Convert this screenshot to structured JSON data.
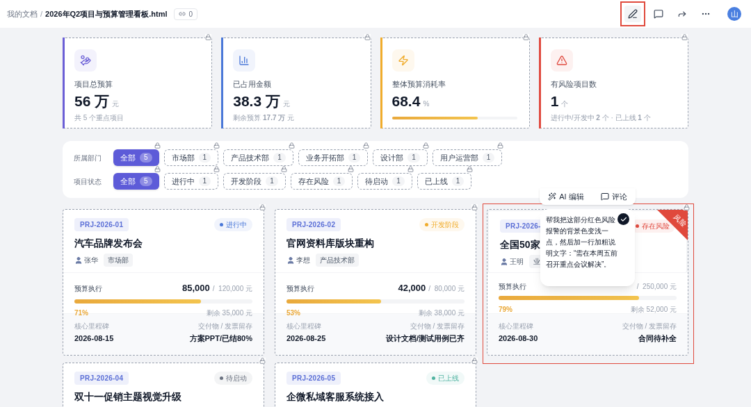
{
  "header": {
    "breadcrumb_parent": "我的文档",
    "separator": "/",
    "title": "2026年Q2项目与预算管理看板.html",
    "link_count": "0",
    "avatar": "山",
    "edit_selected": true
  },
  "stats": [
    {
      "label": "项目总预算",
      "value": "56 万",
      "unit": "元",
      "note": "共 5 个重点项目",
      "color": "#6b5fd6"
    },
    {
      "label": "已占用金额",
      "value": "38.3 万",
      "unit": "元",
      "note": "剩余预算 **17.7 万** 元",
      "color": "#4a78d8"
    },
    {
      "label": "整体预算消耗率",
      "value": "68.4",
      "unit": "%",
      "level": 0.684,
      "color": "#f0ac2c"
    },
    {
      "label": "有风险项目数",
      "value": "1",
      "unit": "个",
      "note": "进行中/开发中 **2** 个 · 已上线 **1** 个",
      "color": "#e04a3f"
    }
  ],
  "filters": [
    {
      "label": "所属部门",
      "options": [
        {
          "label": "全部",
          "count": "5",
          "selected": true
        },
        {
          "label": "市场部",
          "count": "1",
          "selected": false
        },
        {
          "label": "产品技术部",
          "count": "1",
          "selected": false
        },
        {
          "label": "业务开拓部",
          "count": "1",
          "selected": false
        },
        {
          "label": "设计部",
          "count": "1",
          "selected": false
        },
        {
          "label": "用户运营部",
          "count": "1",
          "selected": false
        }
      ]
    },
    {
      "label": "项目状态",
      "options": [
        {
          "label": "全部",
          "count": "5",
          "selected": true
        },
        {
          "label": "进行中",
          "count": "1",
          "selected": false
        },
        {
          "label": "开发阶段",
          "count": "1",
          "selected": false
        },
        {
          "label": "存在风险",
          "count": "1",
          "selected": false
        },
        {
          "label": "待启动",
          "count": "1",
          "selected": false
        },
        {
          "label": "已上线",
          "count": "1",
          "selected": false
        }
      ]
    }
  ],
  "projects": [
    {
      "id": "PRJ-2026-01",
      "status": "进行中",
      "color": "#4a78d8",
      "title": "汽车品牌发布会",
      "owner": "张华",
      "dept": "市场部",
      "budget_label": "预算执行",
      "spent": "85,000",
      "total": "/  120,000 元",
      "level": 0.71,
      "percent": "71%",
      "remain": "剩余 35,000 元",
      "milestone_label": "核心里程碑",
      "milestone": "2026-08-15",
      "deliver_label": "交付物 / 发票留存",
      "deliver": "方案PPT/已结80%",
      "selected": false
    },
    {
      "id": "PRJ-2026-02",
      "status": "开发阶段",
      "color": "#f0ac2c",
      "title": "官网资料库版块重构",
      "owner": "李想",
      "dept": "产品技术部",
      "budget_label": "预算执行",
      "spent": "42,000",
      "total": "/  80,000 元",
      "level": 0.53,
      "percent": "53%",
      "remain": "剩余 38,000 元",
      "milestone_label": "核心里程碑",
      "milestone": "2026-08-25",
      "deliver_label": "交付物 / 发票留存",
      "deliver": "设计文档/测试用例已齐",
      "selected": false
    },
    {
      "id": "PRJ-2026-",
      "status": "存在风险",
      "color": "#e04a3f",
      "title": "全国50家",
      "owner": "王明",
      "dept": "业",
      "budget_label": "预算执行",
      "total": "/  250,000 元",
      "level": 0.79,
      "percent": "79%",
      "remain": "剩余 52,000 元",
      "milestone_label": "核心里程碑",
      "milestone": "2026-08-30",
      "deliver_label": "交付物 / 发票留存",
      "deliver": "合同待补全",
      "ribbon": "风险",
      "selected": true,
      "popup": {
        "actions": [
          "AI 编辑",
          "评论"
        ],
        "comment": "帮我把这部分红色风险报警的背景色变浅一点，然后加一行加粗说明文字：“需在本周五前召开重点会议解决”。"
      }
    },
    {
      "id": "PRJ-2026-04",
      "status": "待启动",
      "color": "#6b7280",
      "title": "双十一促销主题视觉升级",
      "selected": false
    },
    {
      "id": "PRJ-2026-05",
      "status": "已上线",
      "color": "#4fb3a0",
      "title": "企微私域客服系统接入",
      "selected": false
    }
  ]
}
